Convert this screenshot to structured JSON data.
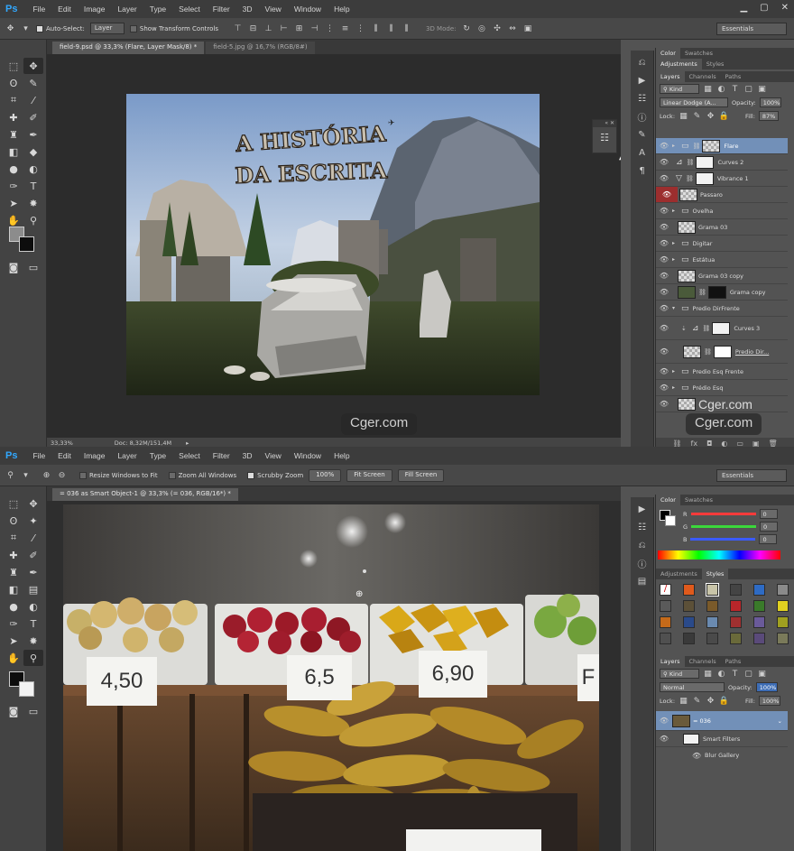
{
  "top": {
    "logo": "Ps",
    "menu": [
      "File",
      "Edit",
      "Image",
      "Layer",
      "Type",
      "Select",
      "Filter",
      "3D",
      "View",
      "Window",
      "Help"
    ],
    "options": {
      "auto_select_label": "Auto-Select:",
      "auto_select_value": "Layer",
      "show_transform_label": "Show Transform Controls",
      "mode_label": "3D Mode:",
      "workspace": "Essentials"
    },
    "tabs": [
      {
        "label": "field-9.psd @ 33,3% (Flare, Layer Mask/8) *"
      },
      {
        "label": "field-5.jpg @ 16,7% (RGB/8#)"
      }
    ],
    "artwork": {
      "title_line1": "A HISTÓRIA",
      "title_line2": "DA ESCRITA"
    },
    "status": {
      "zoom": "33,33%",
      "doc": "Doc: 8,32M/151,4M"
    },
    "watermark": "Cger.com",
    "panel_tabs_top": [
      "Color",
      "Swatches"
    ],
    "panel_tabs_adj": [
      "Adjustments",
      "Styles"
    ],
    "layer_tabs": [
      "Layers",
      "Channels",
      "Paths"
    ],
    "kind_label": "Kind",
    "blend_mode": "Linear Dodge (A...",
    "opacity_label": "Opacity:",
    "opacity_value": "100%",
    "lock_label": "Lock:",
    "fill_label": "Fill:",
    "fill_value": "87%",
    "layers": [
      {
        "name": "Flare",
        "kind": "group-mask",
        "selected": true
      },
      {
        "name": "Curves 2",
        "kind": "adjustment",
        "icon": "curves"
      },
      {
        "name": "Vibrance 1",
        "kind": "adjustment",
        "icon": "vibrance"
      },
      {
        "name": "Passaro",
        "kind": "pixel",
        "eye_red": true
      },
      {
        "name": "Ovelha",
        "kind": "group"
      },
      {
        "name": "Grama 03",
        "kind": "pixel"
      },
      {
        "name": "Digitar",
        "kind": "group"
      },
      {
        "name": "Estátua",
        "kind": "group"
      },
      {
        "name": "Grama 03 copy",
        "kind": "pixel"
      },
      {
        "name": "Grama copy",
        "kind": "pixel-mask-dark"
      },
      {
        "name": "Predio DirFrente",
        "kind": "group-open"
      },
      {
        "name": "Curves 3",
        "kind": "adjustment-indent",
        "icon": "curves"
      },
      {
        "name": "Predio Dir...",
        "kind": "pixel-indent-mask"
      },
      {
        "name": "Predio Esq Frente",
        "kind": "group"
      },
      {
        "name": "Prédio Esq",
        "kind": "group"
      },
      {
        "name": "Cger.com",
        "kind": "pixel"
      }
    ]
  },
  "bottom": {
    "logo": "Ps",
    "menu": [
      "File",
      "Edit",
      "Image",
      "Layer",
      "Type",
      "Select",
      "Filter",
      "3D",
      "View",
      "Window",
      "Help"
    ],
    "options": {
      "resize_label": "Resize Windows to Fit",
      "zoom_all_label": "Zoom All Windows",
      "scrubby_label": "Scrubby Zoom",
      "btn_100": "100%",
      "btn_fit": "Fit Screen",
      "btn_fill": "Fill Screen",
      "workspace": "Essentials"
    },
    "tab": "= 036 as Smart Object-1 @ 33,3% (= 036, RGB/16*) *",
    "prices": [
      "4,50",
      "6,5",
      "6,90",
      "F"
    ],
    "panel_tabs_top": [
      "Color",
      "Swatches"
    ],
    "color_channels": [
      {
        "label": "R",
        "value": "0",
        "color": "#ff3b3b"
      },
      {
        "label": "G",
        "value": "0",
        "color": "#3bd83b"
      },
      {
        "label": "B",
        "value": "0",
        "color": "#3b5bff"
      }
    ],
    "panel_tabs_adj": [
      "Adjustments",
      "Styles"
    ],
    "layer_tabs": [
      "Layers",
      "Channels",
      "Paths"
    ],
    "kind_label": "Kind",
    "blend_mode": "Normal",
    "opacity_label": "Opacity:",
    "opacity_value": "100%",
    "lock_label": "Lock:",
    "fill_label": "Fill:",
    "fill_value": "100%",
    "layers": [
      {
        "name": "= 036",
        "kind": "smart"
      },
      {
        "name": "Smart Filters",
        "kind": "filter-mask"
      },
      {
        "name": "Blur Gallery",
        "kind": "filter"
      }
    ]
  }
}
